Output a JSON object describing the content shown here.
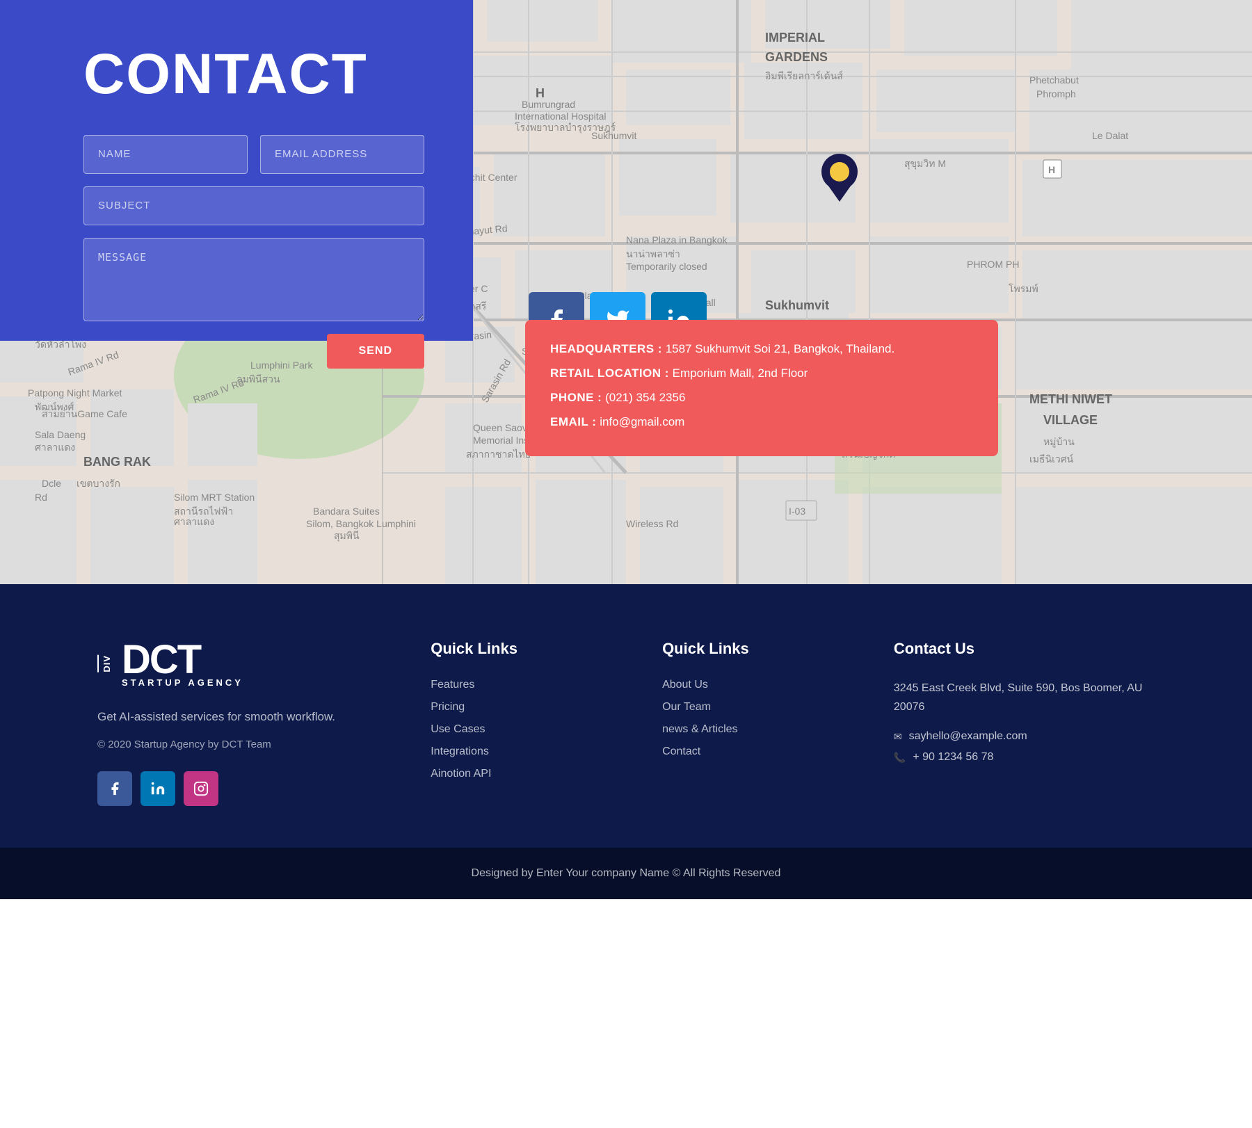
{
  "contact": {
    "title": "CONTACT",
    "form": {
      "name_placeholder": "NAME",
      "email_placeholder": "EMAIL ADDRESS",
      "subject_placeholder": "SUBJECT",
      "message_placeholder": "MESSAGE",
      "submit_label": "SEND"
    },
    "social": {
      "facebook": "f",
      "twitter": "t",
      "linkedin": "in"
    },
    "info": {
      "headquarters_label": "HEADQUARTERS :",
      "headquarters_value": " 1587 Sukhumvit Soi 21, Bangkok, Thailand.",
      "retail_label": "RETAIL LOCATION :",
      "retail_value": " Emporium Mall, 2nd Floor",
      "phone_label": "PHONE :",
      "phone_value": " (021) 354 2356",
      "email_label": "EMAIL :",
      "email_value": " info@gmail.com"
    }
  },
  "footer": {
    "brand": {
      "divs_label": "DIV",
      "dct_label": "DCT",
      "subtitle": "STARTUP AGENCY",
      "tagline": "Get AI-assisted services for smooth workflow.",
      "copyright": "© 2020 Startup Agency by DCT Team"
    },
    "quick_links_1": {
      "title": "Quick Links",
      "items": [
        {
          "label": "Features",
          "href": "#"
        },
        {
          "label": "Pricing",
          "href": "#"
        },
        {
          "label": "Use Cases",
          "href": "#"
        },
        {
          "label": "Integrations",
          "href": "#"
        },
        {
          "label": "Ainotion API",
          "href": "#"
        }
      ]
    },
    "quick_links_2": {
      "title": "Quick Links",
      "items": [
        {
          "label": "About Us",
          "href": "#"
        },
        {
          "label": "Our Team",
          "href": "#"
        },
        {
          "label": "news & Articles",
          "href": "#"
        },
        {
          "label": "Contact",
          "href": "#"
        }
      ]
    },
    "contact_us": {
      "title": "Contact Us",
      "address": "3245 East Creek Blvd, Suite 590, Bos Boomer, AU 20076",
      "email": "sayhello@example.com",
      "phone": "+ 90 1234 56 78"
    }
  },
  "bottom_bar": {
    "text": "Designed by Enter Your company Name © All Rights Reserved"
  },
  "colors": {
    "blue_panel": "#3b4bc8",
    "red_accent": "#f05a5a",
    "footer_bg": "#0d1a4a",
    "bottom_bar_bg": "#060e2a"
  }
}
